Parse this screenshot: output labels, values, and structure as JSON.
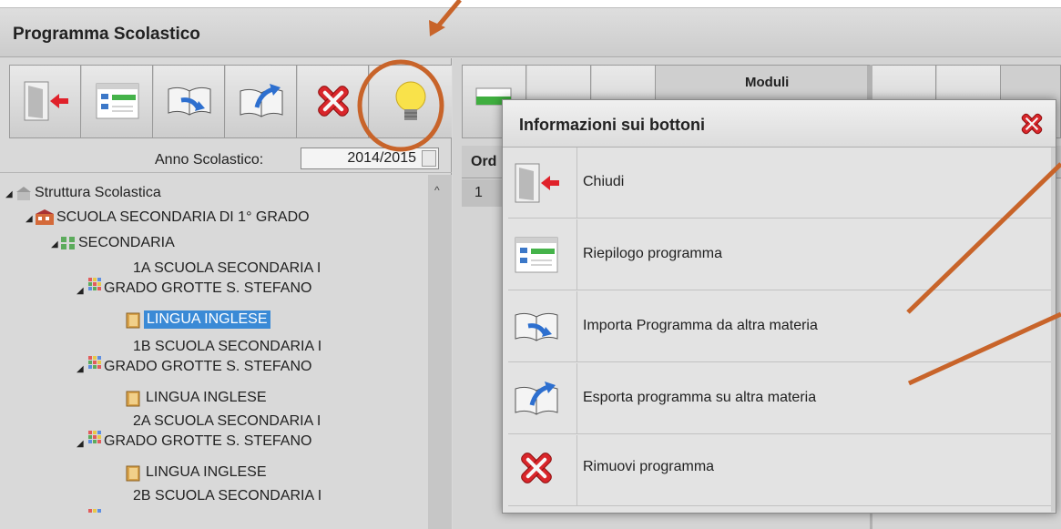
{
  "window": {
    "title": "Programma Scolastico"
  },
  "left": {
    "year_label": "Anno Scolastico:",
    "year_value": "2014/2015",
    "tree": [
      {
        "label": "Struttura Scolastica"
      },
      {
        "label": "SCUOLA SECONDARIA DI 1° GRADO"
      },
      {
        "label": "SECONDARIA"
      },
      {
        "label_line1": "1A SCUOLA SECONDARIA I",
        "label_line2": "GRADO GROTTE S. STEFANO"
      },
      {
        "label": "LINGUA INGLESE",
        "selected": true
      },
      {
        "label_line1": "1B SCUOLA SECONDARIA I",
        "label_line2": "GRADO GROTTE S. STEFANO"
      },
      {
        "label": "LINGUA INGLESE"
      },
      {
        "label_line1": "2A SCUOLA SECONDARIA I",
        "label_line2": "GRADO GROTTE S. STEFANO"
      },
      {
        "label": "LINGUA INGLESE"
      },
      {
        "label_line1": "2B SCUOLA SECONDARIA I"
      }
    ]
  },
  "right": {
    "moduli_label": "Moduli",
    "col_ord": "Ord",
    "row_ord": "1"
  },
  "dialog": {
    "title": "Informazioni sui bottoni",
    "items": [
      {
        "icon": "exit-door-icon",
        "label": "Chiudi"
      },
      {
        "icon": "summary-icon",
        "label": "Riepilogo programma"
      },
      {
        "icon": "import-book-icon",
        "label": "Importa Programma da altra materia"
      },
      {
        "icon": "export-book-icon",
        "label": "Esporta programma su altra materia"
      },
      {
        "icon": "remove-icon",
        "label": "Rimuovi programma"
      }
    ]
  },
  "colors": {
    "selection": "#3a8ad6",
    "annotation": "#c8642a",
    "remove_red": "#d9262b"
  }
}
